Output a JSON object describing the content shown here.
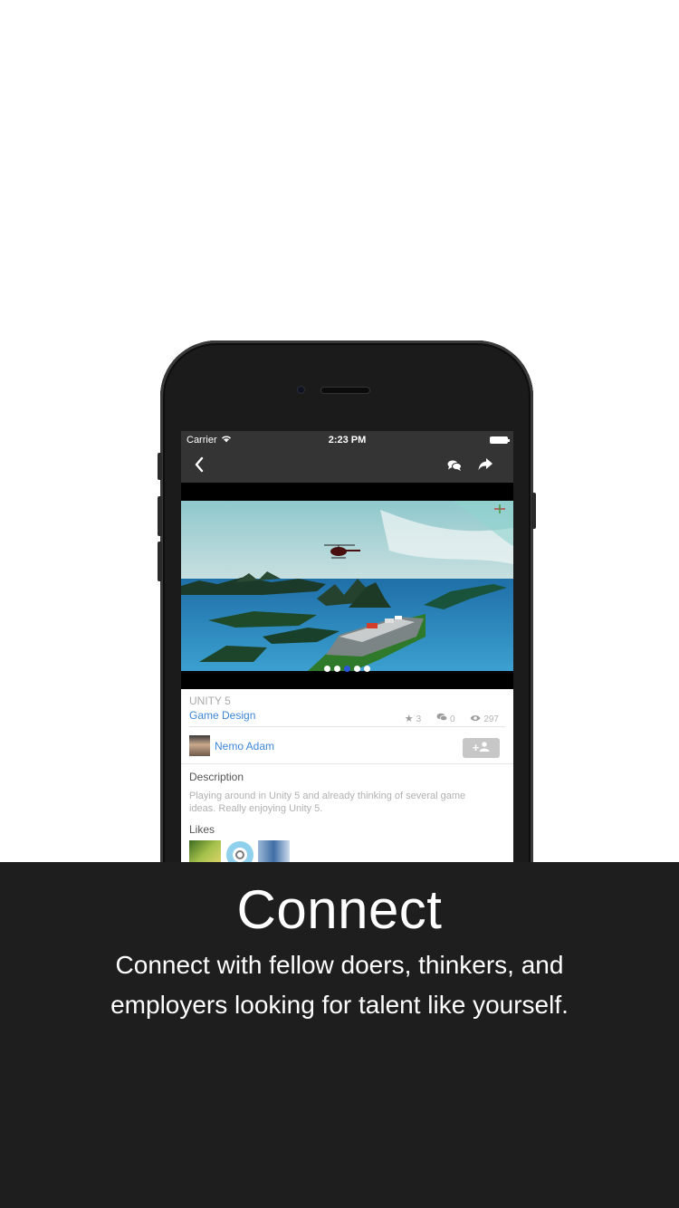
{
  "status_bar": {
    "carrier": "Carrier",
    "time": "2:23 PM"
  },
  "nav": {
    "back_icon": "chevron-left-icon",
    "chat_icon": "chat-bubbles-icon",
    "share_icon": "share-icon"
  },
  "gallery": {
    "slide_count": 5,
    "active_index": 2
  },
  "project": {
    "category": "UNITY 5",
    "tag": "Game Design",
    "stats": {
      "stars": "3",
      "comments": "0",
      "views": "297"
    }
  },
  "author": {
    "name": "Nemo Adam",
    "follow_label": "+"
  },
  "description": {
    "label": "Description",
    "text": "Playing around in Unity 5 and already thinking of several game ideas.  Really enjoying Unity 5."
  },
  "likes": {
    "label": "Likes"
  },
  "promo": {
    "title": "Connect",
    "text": "Connect with fellow doers, thinkers, and employers looking for talent like yourself."
  },
  "colors": {
    "accent": "#3d86d8",
    "bar": "#343434",
    "panel": "#1e1e1e"
  }
}
